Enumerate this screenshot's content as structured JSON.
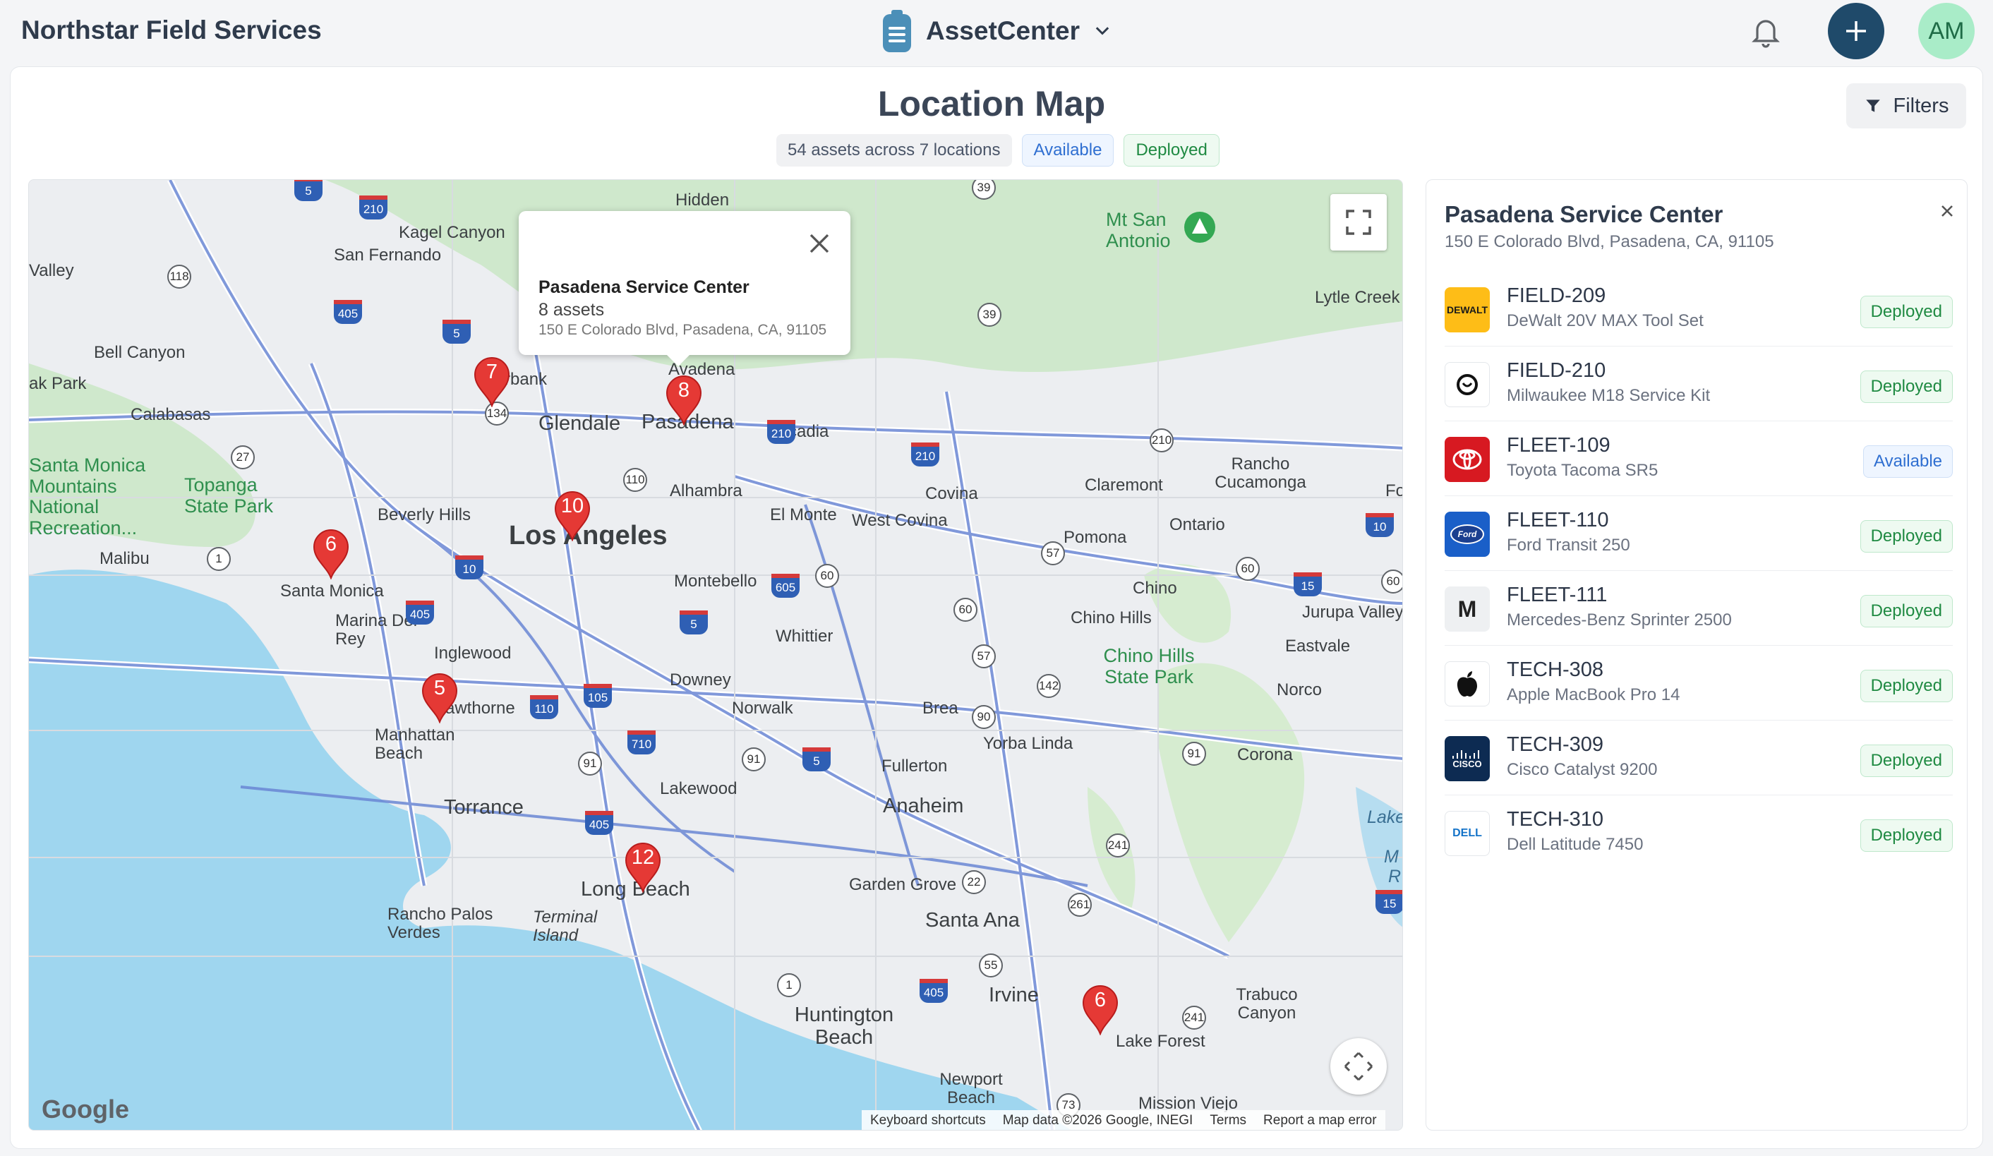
{
  "header": {
    "brand": "Northstar Field Services",
    "app_name": "AssetCenter",
    "avatar_initials": "AM"
  },
  "page": {
    "title": "Location Map",
    "filters_label": "Filters",
    "summary": "54 assets across 7 locations",
    "legend_available": "Available",
    "legend_deployed": "Deployed"
  },
  "map": {
    "labels": [
      "Hidden",
      "Kagel Canyon",
      "San Fernando",
      "Valley",
      "Bell Canyon",
      "ak Park",
      "Calabasas",
      "Santa Monica Mountains National Recreation...",
      "Topanga State Park",
      "Malibu",
      "Beverly Hills",
      "Santa Monica",
      "Marina Del Rey",
      "Inglewood",
      "awthorne",
      "Manhattan Beach",
      "Torrance",
      "Rancho Palos Verdes",
      "Terminal Island",
      "Long Beach",
      "Lakewood",
      "Downey",
      "Norwalk",
      "Whittier",
      "Montebello",
      "El Monte",
      "West Covina",
      "Alhambra",
      "Los Angeles",
      "Glendale",
      "Pasadena",
      "Arcadia",
      "Covina",
      "Claremont",
      "Pomona",
      "Ontario",
      "Rancho Cucamonga",
      "Mt San Antonio",
      "Lytle Creek",
      "Chino",
      "Chino Hills",
      "Chino Hills State Park",
      "Eastvale",
      "Norco",
      "Jurupa Valley",
      "Brea",
      "Yorba Linda",
      "Fullerton",
      "Corona",
      "Anaheim",
      "Garden Grove",
      "Santa Ana",
      "Irvine",
      "Huntington Beach",
      "Newport Beach",
      "Lake Forest",
      "Trabuco Canyon",
      "Mission Viejo",
      "rbank",
      "Avadena",
      "Fo",
      "Lake",
      "M",
      "R"
    ],
    "popup": {
      "title": "Pasadena Service Center",
      "count": "8 assets",
      "address": "150 E Colorado Blvd, Pasadena, CA, 91105"
    },
    "markers": [
      "7",
      "8",
      "10",
      "6",
      "5",
      "12",
      "6"
    ],
    "attribution": [
      "Keyboard shortcuts",
      "Map data ©2026 Google, INEGI",
      "Terms",
      "Report a map error"
    ],
    "google_label": "Google"
  },
  "panel": {
    "title": "Pasadena Service Center",
    "address": "150 E Colorado Blvd, Pasadena, CA, 91105",
    "assets": [
      {
        "id": "FIELD-209",
        "name": "DeWalt 20V MAX Tool Set",
        "status": "Deployed",
        "logo": "DEWALT"
      },
      {
        "id": "FIELD-210",
        "name": "Milwaukee M18 Service Kit",
        "status": "Deployed",
        "logo": "milwaukee-icon"
      },
      {
        "id": "FLEET-109",
        "name": "Toyota Tacoma SR5",
        "status": "Available",
        "logo": "toyota-icon"
      },
      {
        "id": "FLEET-110",
        "name": "Ford Transit 250",
        "status": "Deployed",
        "logo": "Ford"
      },
      {
        "id": "FLEET-111",
        "name": "Mercedes-Benz Sprinter 2500",
        "status": "Deployed",
        "logo": "M"
      },
      {
        "id": "TECH-308",
        "name": "Apple MacBook Pro 14",
        "status": "Deployed",
        "logo": "apple-icon"
      },
      {
        "id": "TECH-309",
        "name": "Cisco Catalyst 9200",
        "status": "Deployed",
        "logo": "CISCO"
      },
      {
        "id": "TECH-310",
        "name": "Dell Latitude 7450",
        "status": "Deployed",
        "logo": "DELL"
      }
    ]
  },
  "colors": {
    "accent": "#1f4a6a",
    "avatar_bg": "#a9ecc8",
    "marker": "#e53935",
    "water": "#9fd6ef",
    "deployed": "#1f8a42",
    "available": "#2f6fd1"
  }
}
